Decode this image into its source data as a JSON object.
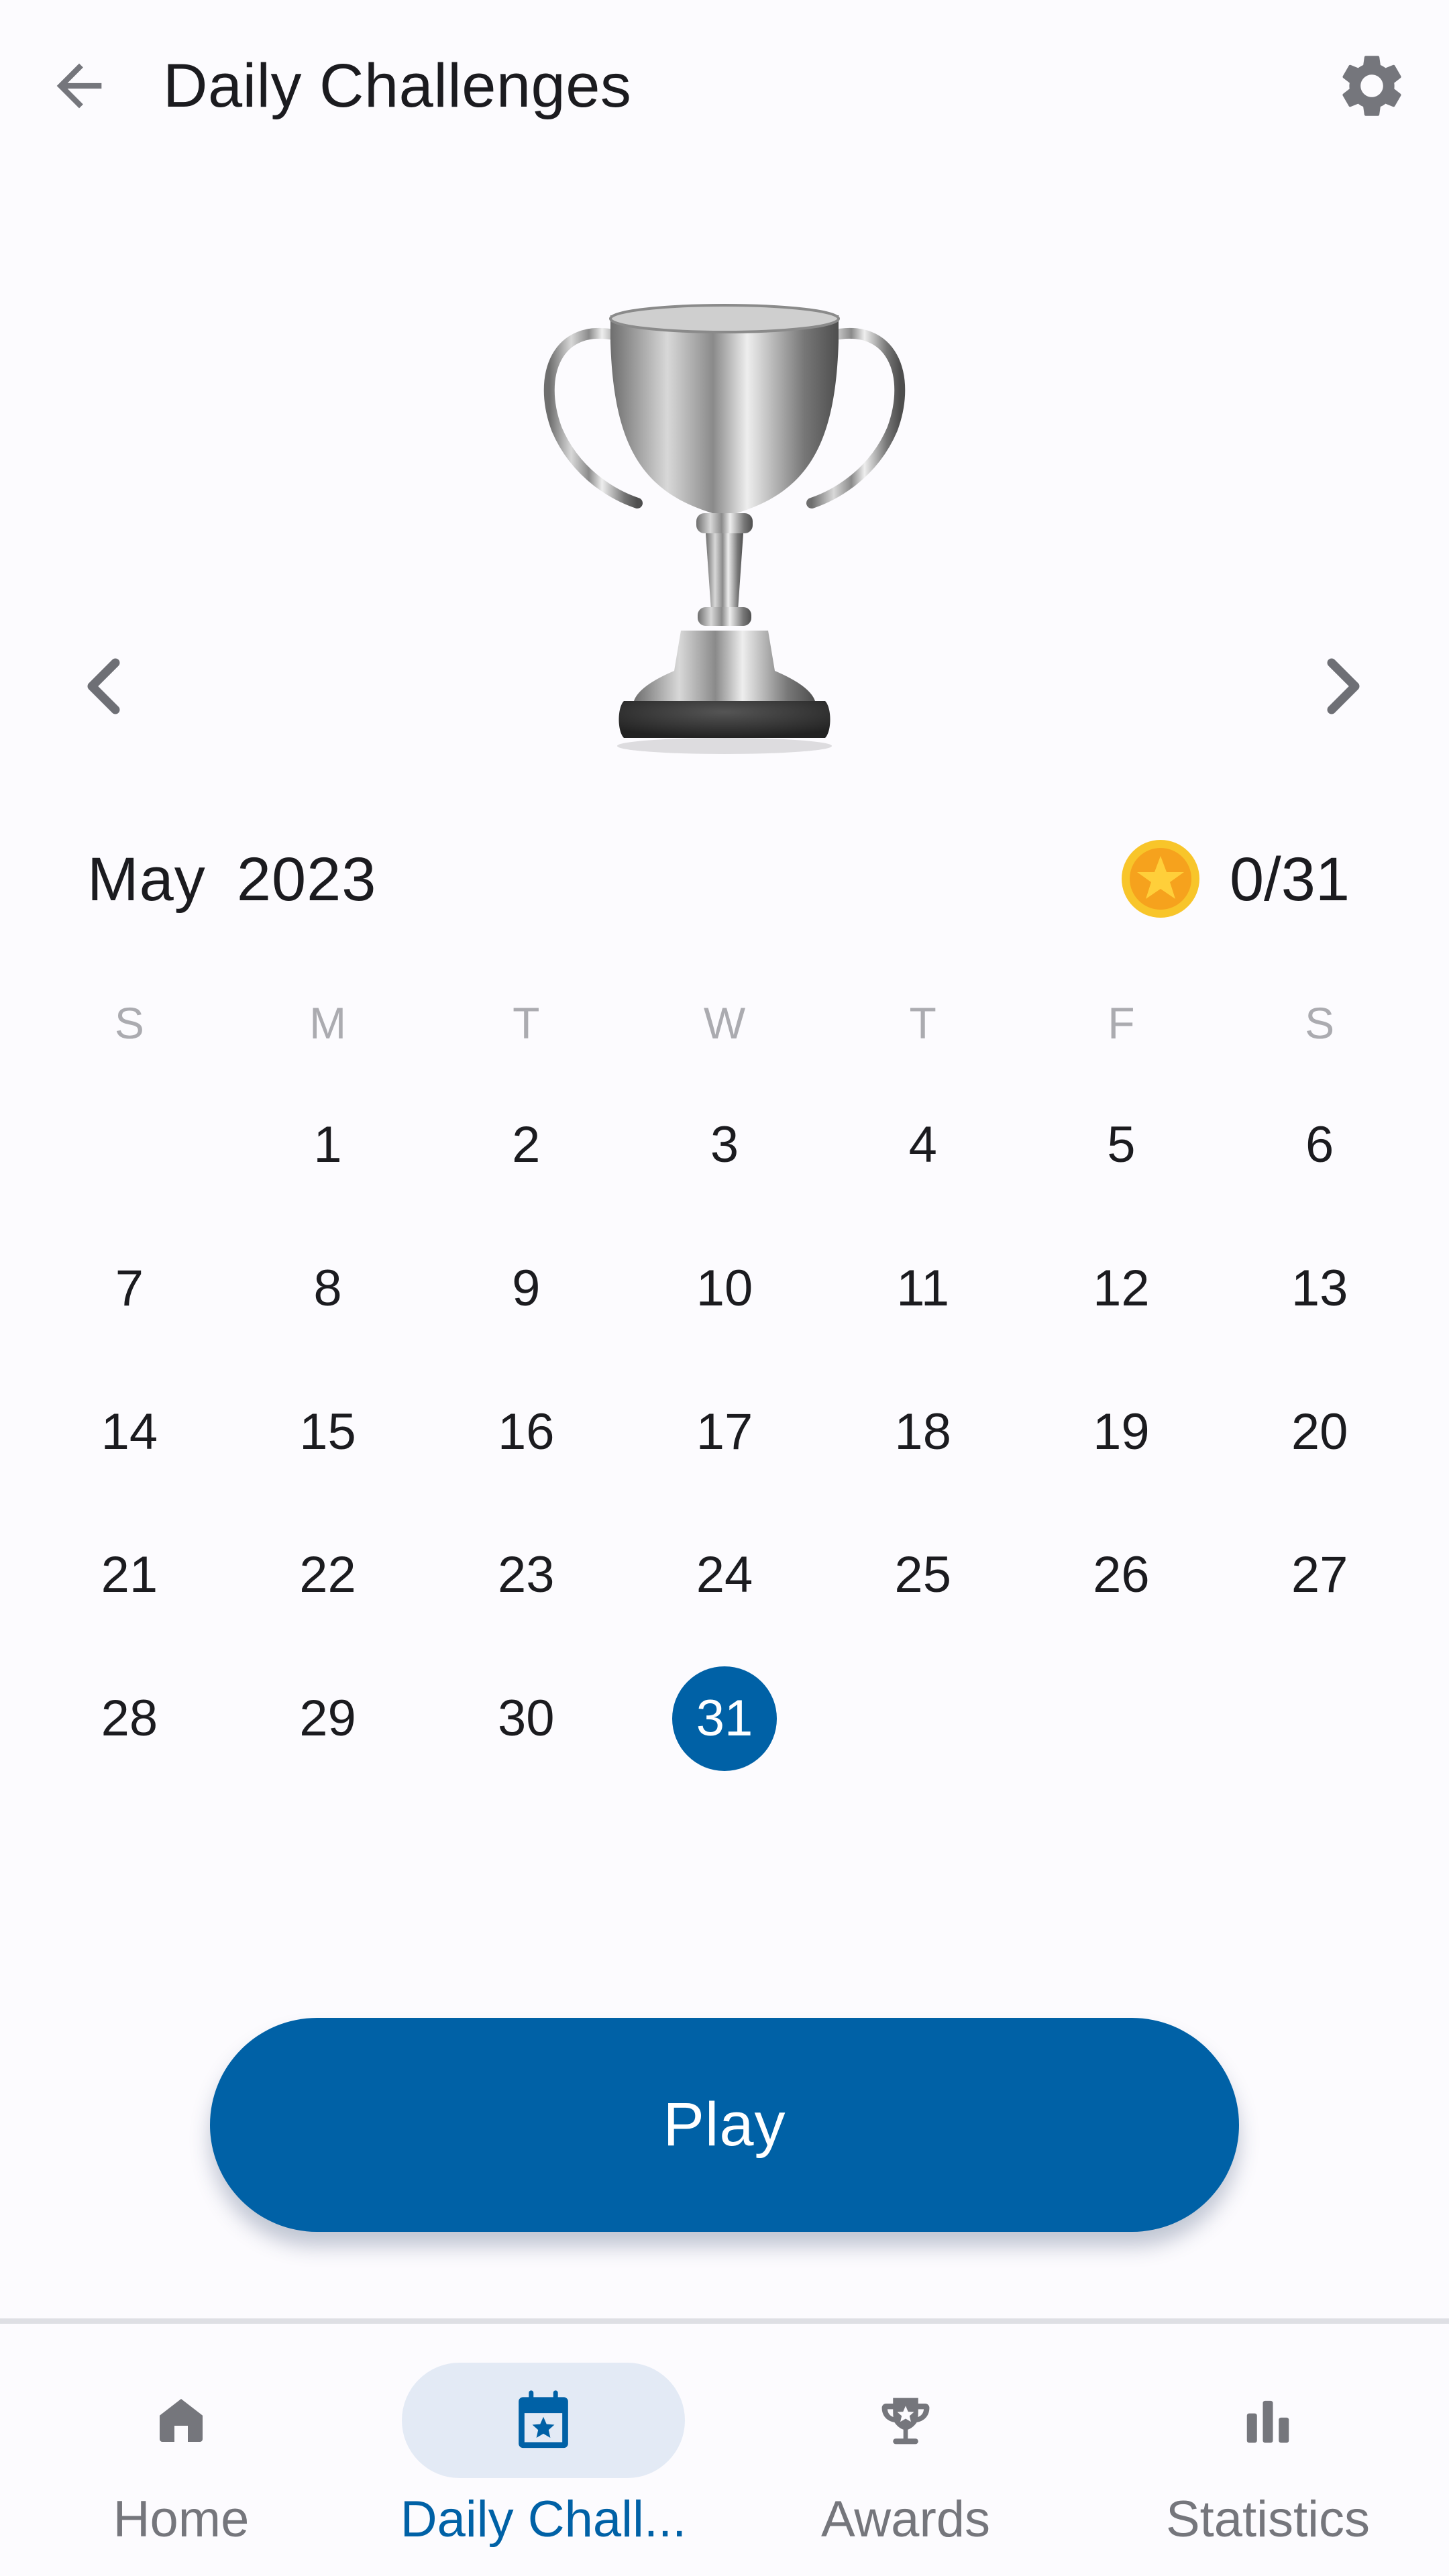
{
  "topbar": {
    "title": "Daily Challenges",
    "back_icon": "arrow-back-icon",
    "settings_icon": "gear-icon"
  },
  "hero": {
    "image": "silver-trophy-cup",
    "prev_icon": "chevron-left-icon",
    "next_icon": "chevron-right-icon"
  },
  "calendar": {
    "month": "May",
    "year": "2023",
    "coin_icon": "star-coin-icon",
    "progress": "0/31",
    "completed": 0,
    "total": 31,
    "weekdays": [
      "S",
      "M",
      "T",
      "W",
      "T",
      "F",
      "S"
    ],
    "leading_blanks": 1,
    "days": [
      "1",
      "2",
      "3",
      "4",
      "5",
      "6",
      "7",
      "8",
      "9",
      "10",
      "11",
      "12",
      "13",
      "14",
      "15",
      "16",
      "17",
      "18",
      "19",
      "20",
      "21",
      "22",
      "23",
      "24",
      "25",
      "26",
      "27",
      "28",
      "29",
      "30",
      "31"
    ],
    "selected_day": "31"
  },
  "play_button": {
    "label": "Play"
  },
  "bottom_nav": {
    "items": [
      {
        "label": "Home",
        "icon": "home-icon",
        "active": false
      },
      {
        "label": "Daily Chall...",
        "icon": "calendar-star-icon",
        "active": true
      },
      {
        "label": "Awards",
        "icon": "trophy-icon",
        "active": false
      },
      {
        "label": "Statistics",
        "icon": "bar-chart-icon",
        "active": false
      }
    ]
  },
  "colors": {
    "primary": "#0061A6",
    "active_pill": "#E3EAF5",
    "icon_gray": "#75767C",
    "weekday_gray": "#ABABB0",
    "background": "#FCFBFE"
  }
}
